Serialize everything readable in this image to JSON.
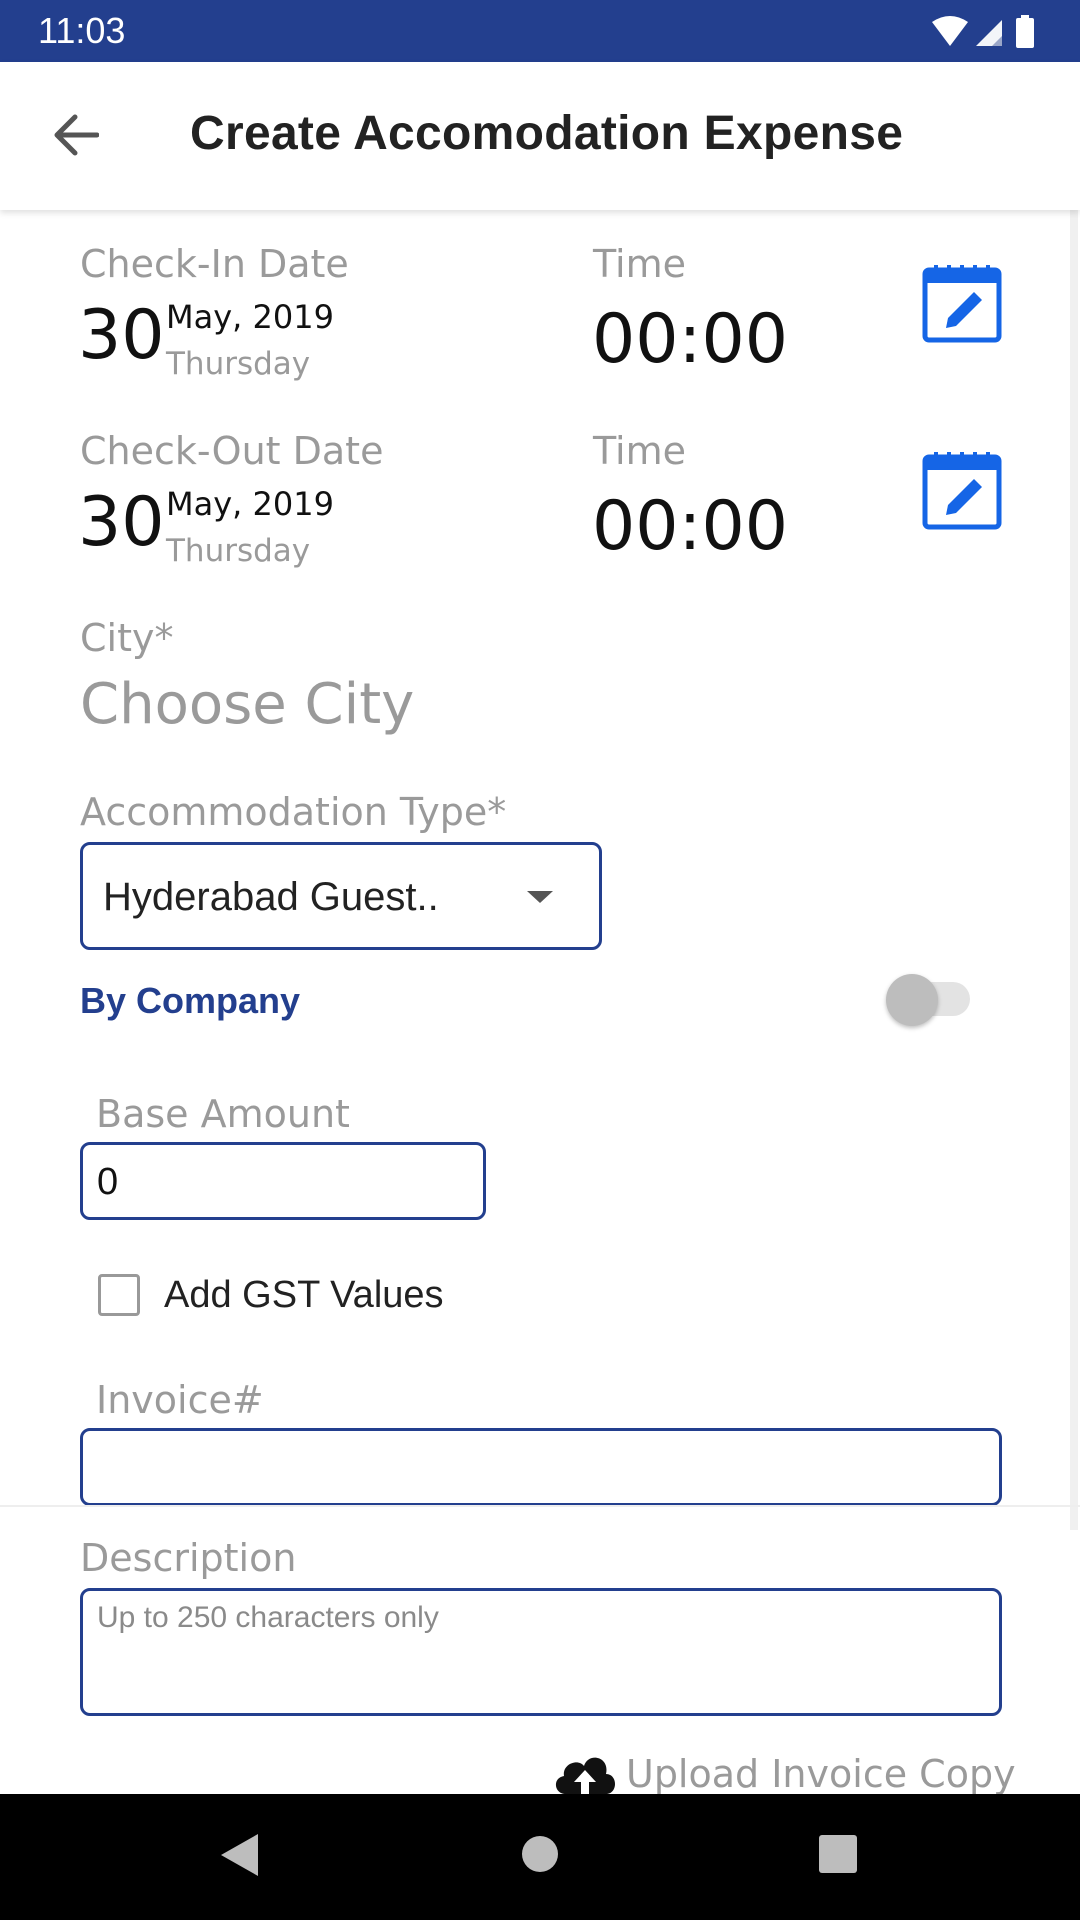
{
  "status_bar": {
    "time": "11:03"
  },
  "header": {
    "title": "Create Accomodation Expense"
  },
  "check_in": {
    "label": "Check-In Date",
    "day": "30",
    "month_year": "May, 2019",
    "weekday": "Thursday",
    "time_label": "Time",
    "time": "00:00"
  },
  "check_out": {
    "label": "Check-Out Date",
    "day": "30",
    "month_year": "May, 2019",
    "weekday": "Thursday",
    "time_label": "Time",
    "time": "00:00"
  },
  "city": {
    "label": "City*",
    "placeholder": "Choose City"
  },
  "accommodation": {
    "label": "Accommodation Type*",
    "selected": "Hyderabad Guest.."
  },
  "by_company": {
    "label": "By Company",
    "enabled": false
  },
  "base_amount": {
    "label": "Base Amount",
    "value": "0"
  },
  "gst": {
    "label": "Add GST Values",
    "checked": false
  },
  "invoice": {
    "label": "Invoice#",
    "value": ""
  },
  "description": {
    "label": "Description",
    "placeholder": "Up to 250 characters only"
  },
  "upload": {
    "label": "Upload Invoice Copy"
  },
  "colors": {
    "primary": "#233f8e",
    "accent": "#1565e6",
    "muted": "#9a9a9a"
  }
}
